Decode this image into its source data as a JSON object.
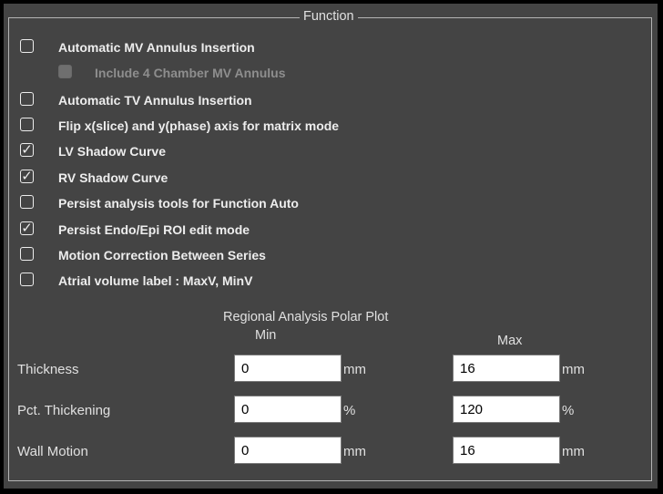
{
  "function_group": {
    "title": "Function",
    "options": [
      {
        "label": "Automatic MV Annulus Insertion",
        "checked": false,
        "enabled": true
      },
      {
        "label": "Include 4 Chamber MV Annulus",
        "checked": false,
        "enabled": false
      },
      {
        "label": "Automatic TV Annulus Insertion",
        "checked": false,
        "enabled": true
      },
      {
        "label": "Flip x(slice) and y(phase) axis for matrix mode",
        "checked": false,
        "enabled": true
      },
      {
        "label": "LV Shadow Curve",
        "checked": true,
        "enabled": true
      },
      {
        "label": "RV Shadow Curve",
        "checked": true,
        "enabled": true
      },
      {
        "label": "Persist analysis tools for Function Auto",
        "checked": false,
        "enabled": true
      },
      {
        "label": "Persist Endo/Epi ROI edit mode",
        "checked": true,
        "enabled": true
      },
      {
        "label": "Motion Correction Between Series",
        "checked": false,
        "enabled": true
      },
      {
        "label": "Atrial volume label : MaxV, MinV",
        "checked": false,
        "enabled": true
      }
    ]
  },
  "polar_plot": {
    "title": "Regional Analysis Polar Plot",
    "min_header": "Min",
    "max_header": "Max",
    "rows": [
      {
        "label": "Thickness",
        "min_value": "0",
        "min_unit": "mm",
        "max_value": "16",
        "max_unit": "mm"
      },
      {
        "label": "Pct. Thickening",
        "min_value": "0",
        "min_unit": "%",
        "max_value": "120",
        "max_unit": "%"
      },
      {
        "label": "Wall Motion",
        "min_value": "0",
        "min_unit": "mm",
        "max_value": "16",
        "max_unit": "mm"
      }
    ]
  },
  "colors": {
    "panel_bg": "#444444",
    "text": "#e0e0e0",
    "disabled_text": "#8e8e8e"
  },
  "icons": {
    "checked_mark": "check-icon"
  }
}
